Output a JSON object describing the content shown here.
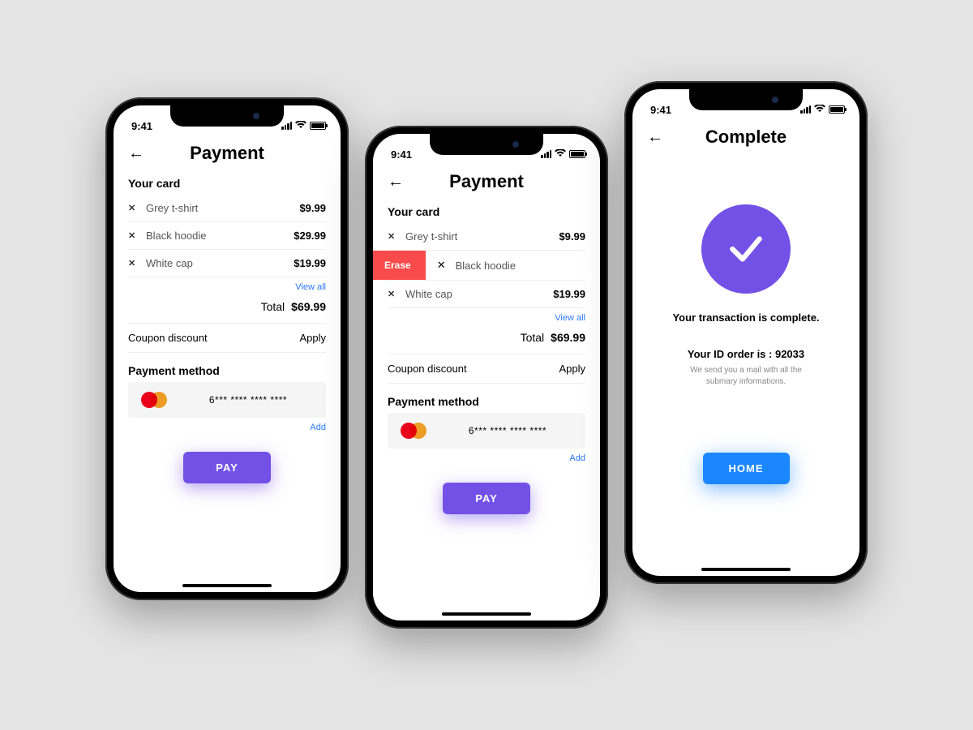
{
  "status": {
    "time": "9:41"
  },
  "screen1": {
    "title": "Payment",
    "cart_heading": "Your card",
    "items": [
      {
        "name": "Grey t-shirt",
        "price": "$9.99"
      },
      {
        "name": "Black hoodie",
        "price": "$29.99"
      },
      {
        "name": "White cap",
        "price": "$19.99"
      }
    ],
    "view_all": "View all",
    "total_label": "Total",
    "total_value": "$69.99",
    "coupon_label": "Coupon discount",
    "coupon_action": "Apply",
    "method_heading": "Payment method",
    "card_masked": "6*** **** **** ****",
    "add_link": "Add",
    "pay": "PAY"
  },
  "screen2": {
    "title": "Payment",
    "cart_heading": "Your card",
    "items": [
      {
        "name": "Grey t-shirt",
        "price": "$9.99"
      },
      {
        "name": "Black hoodie",
        "price": ""
      },
      {
        "name": "White cap",
        "price": "$19.99"
      }
    ],
    "erase": "Erase",
    "view_all": "View all",
    "total_label": "Total",
    "total_value": "$69.99",
    "coupon_label": "Coupon discount",
    "coupon_action": "Apply",
    "method_heading": "Payment method",
    "card_masked": "6*** **** **** ****",
    "add_link": "Add",
    "pay": "PAY"
  },
  "screen3": {
    "title": "Complete",
    "message": "Your transaction is complete.",
    "order_line": "Your ID order is : 92033",
    "subtext": "We send you a mail with all the submary informations.",
    "home": "HOME"
  }
}
